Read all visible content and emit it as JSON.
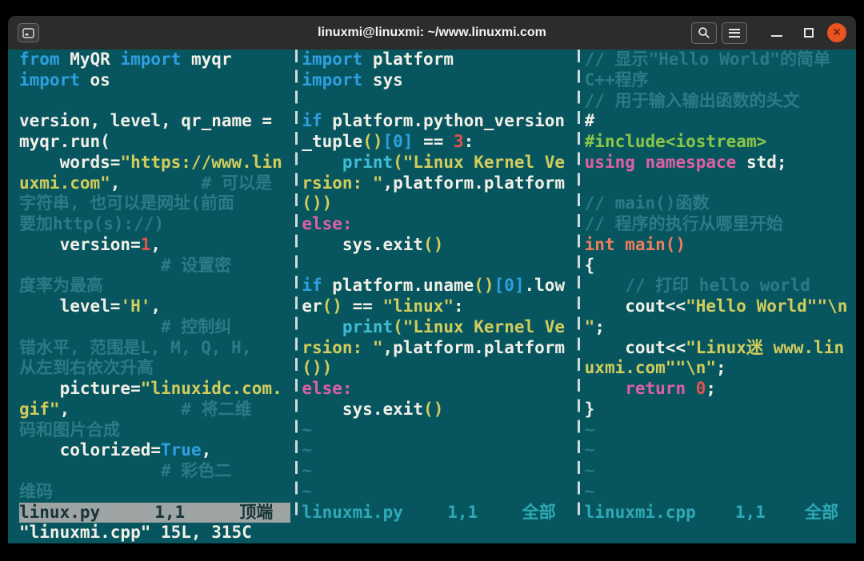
{
  "colors": {
    "bg": "#07565f",
    "fg": "#f2efe7",
    "kw": "#2f9fe0",
    "st": "#d2cc5c",
    "nm": "#e4524c",
    "fn": "#41bcd6",
    "mg": "#df5fa4",
    "gr": "#8bc546",
    "or": "#ef7e5e",
    "cm": "#2a7b85",
    "tl": "#2a7b85",
    "sfg": "#2fa9b6",
    "sabg": "#9ea4a3",
    "safg": "#17343a",
    "titlebg": "#2c2c2c",
    "titlefg": "#f3f3f3",
    "close": "#e95420",
    "btnborder": "#6e6e6e",
    "sep": "#cfdbdb"
  },
  "titlebar": {
    "title": "linuxmi@linuxmi: ~/www.linuxmi.com",
    "close_glyph": "✕"
  },
  "cmdline": "\"linuxmi.cpp\" 15L, 315C",
  "panes": [
    {
      "status": {
        "name": "linux.py",
        "ruler": "1,1",
        "pos": "顶端"
      },
      "lines": [
        [
          {
            "t": "from",
            "c": "kw"
          },
          {
            "t": " MyQR ",
            "c": "tx"
          },
          {
            "t": "import",
            "c": "kw"
          },
          {
            "t": " myqr",
            "c": "tx"
          }
        ],
        [
          {
            "t": "import",
            "c": "kw"
          },
          {
            "t": " os",
            "c": "tx"
          }
        ],
        [],
        [
          {
            "t": "version, level, qr_name =",
            "c": "tx"
          }
        ],
        [
          {
            "t": "myqr.run(",
            "c": "tx"
          }
        ],
        [
          {
            "t": "    words=",
            "c": "tx"
          },
          {
            "t": "\"https://www.lin",
            "c": "st"
          }
        ],
        [
          {
            "t": "uxmi.com\"",
            "c": "st"
          },
          {
            "t": ",        ",
            "c": "tx"
          },
          {
            "t": "# 可以是",
            "c": "cm"
          }
        ],
        [
          {
            "t": "字符串, 也可以是网址(前面",
            "c": "cm"
          }
        ],
        [
          {
            "t": "要加http(s)://)",
            "c": "cm"
          }
        ],
        [
          {
            "t": "    version=",
            "c": "tx"
          },
          {
            "t": "1",
            "c": "nm"
          },
          {
            "t": ",",
            "c": "tx"
          }
        ],
        [
          {
            "t": "              ",
            "c": "tx"
          },
          {
            "t": "# 设置密",
            "c": "cm"
          }
        ],
        [
          {
            "t": "度率为最高",
            "c": "cm"
          }
        ],
        [
          {
            "t": "    level=",
            "c": "tx"
          },
          {
            "t": "'H'",
            "c": "st"
          },
          {
            "t": ",",
            "c": "tx"
          }
        ],
        [
          {
            "t": "              ",
            "c": "tx"
          },
          {
            "t": "# 控制纠",
            "c": "cm"
          }
        ],
        [
          {
            "t": "错水平, 范围是L, M, Q, H,",
            "c": "cm"
          }
        ],
        [
          {
            "t": "从左到右依次升高",
            "c": "cm"
          }
        ],
        [
          {
            "t": "    picture=",
            "c": "tx"
          },
          {
            "t": "\"linuxidc.com.",
            "c": "st"
          }
        ],
        [
          {
            "t": "gif\"",
            "c": "st"
          },
          {
            "t": ",           ",
            "c": "tx"
          },
          {
            "t": "# 将二维",
            "c": "cm"
          }
        ],
        [
          {
            "t": "码和图片合成",
            "c": "cm"
          }
        ],
        [
          {
            "t": "    colorized=",
            "c": "tx"
          },
          {
            "t": "True",
            "c": "kw"
          },
          {
            "t": ",",
            "c": "tx"
          }
        ],
        [
          {
            "t": "              ",
            "c": "tx"
          },
          {
            "t": "# 彩色二",
            "c": "cm"
          }
        ],
        [
          {
            "t": "维码",
            "c": "cm"
          }
        ]
      ]
    },
    {
      "status": {
        "name": "linuxmi.py",
        "ruler": "1,1",
        "pos": "全部"
      },
      "lines": [
        [
          {
            "t": "import",
            "c": "kw"
          },
          {
            "t": " platform",
            "c": "tx"
          }
        ],
        [
          {
            "t": "import",
            "c": "kw"
          },
          {
            "t": " sys",
            "c": "tx"
          }
        ],
        [],
        [
          {
            "t": "if",
            "c": "kw"
          },
          {
            "t": " platform.python_version",
            "c": "tx"
          }
        ],
        [
          {
            "t": "_tuple",
            "c": "tx"
          },
          {
            "t": "()",
            "c": "st"
          },
          {
            "t": "[0]",
            "c": "kw"
          },
          {
            "t": " == ",
            "c": "tx"
          },
          {
            "t": "3",
            "c": "nm"
          },
          {
            "t": ":",
            "c": "tx"
          }
        ],
        [
          {
            "t": "    ",
            "c": "tx"
          },
          {
            "t": "print",
            "c": "fn"
          },
          {
            "t": "(\"Linux Kernel Ve",
            "c": "st"
          }
        ],
        [
          {
            "t": "rsion: \"",
            "c": "st"
          },
          {
            "t": ",platform.platform",
            "c": "tx"
          }
        ],
        [
          {
            "t": "())",
            "c": "st"
          }
        ],
        [
          {
            "t": "else:",
            "c": "mg"
          }
        ],
        [
          {
            "t": "    sys.exit",
            "c": "tx"
          },
          {
            "t": "()",
            "c": "st"
          }
        ],
        [],
        [
          {
            "t": "if",
            "c": "kw"
          },
          {
            "t": " platform.uname",
            "c": "tx"
          },
          {
            "t": "()",
            "c": "st"
          },
          {
            "t": "[0]",
            "c": "kw"
          },
          {
            "t": ".low",
            "c": "tx"
          }
        ],
        [
          {
            "t": "er",
            "c": "tx"
          },
          {
            "t": "()",
            "c": "st"
          },
          {
            "t": " == ",
            "c": "tx"
          },
          {
            "t": "\"linux\"",
            "c": "st"
          },
          {
            "t": ":",
            "c": "tx"
          }
        ],
        [
          {
            "t": "    ",
            "c": "tx"
          },
          {
            "t": "print",
            "c": "fn"
          },
          {
            "t": "(\"Linux Kernel Ve",
            "c": "st"
          }
        ],
        [
          {
            "t": "rsion: \"",
            "c": "st"
          },
          {
            "t": ",platform.platform",
            "c": "tx"
          }
        ],
        [
          {
            "t": "())",
            "c": "st"
          }
        ],
        [
          {
            "t": "else:",
            "c": "mg"
          }
        ],
        [
          {
            "t": "    sys.exit",
            "c": "tx"
          },
          {
            "t": "()",
            "c": "st"
          }
        ],
        [
          {
            "t": "~",
            "c": "tl"
          }
        ],
        [
          {
            "t": "~",
            "c": "tl"
          }
        ],
        [
          {
            "t": "~",
            "c": "tl"
          }
        ],
        [
          {
            "t": "~",
            "c": "tl"
          }
        ]
      ]
    },
    {
      "status": {
        "name": "linuxmi.cpp",
        "ruler": "1,1",
        "pos": "全部"
      },
      "lines": [
        [
          {
            "t": "// 显示\"Hello World\"的简单",
            "c": "cm"
          }
        ],
        [
          {
            "t": "C++程序",
            "c": "cm"
          }
        ],
        [
          {
            "t": "// 用于输入输出函数的头文",
            "c": "cm"
          }
        ],
        [
          {
            "t": "#",
            "c": "tx"
          }
        ],
        [
          {
            "t": "#include<iostream>",
            "c": "gr"
          }
        ],
        [
          {
            "t": "using namespace",
            "c": "mg"
          },
          {
            "t": " std;",
            "c": "tx"
          }
        ],
        [],
        [
          {
            "t": "// main()函数",
            "c": "cm"
          }
        ],
        [
          {
            "t": "// 程序的执行从哪里开始",
            "c": "cm"
          }
        ],
        [
          {
            "t": "int main()",
            "c": "or"
          }
        ],
        [
          {
            "t": "{",
            "c": "tx"
          }
        ],
        [
          {
            "t": "    ",
            "c": "tx"
          },
          {
            "t": "// 打印 hello world",
            "c": "cm"
          }
        ],
        [
          {
            "t": "    cout<<",
            "c": "tx"
          },
          {
            "t": "\"Hello World\"\"\\n",
            "c": "st"
          }
        ],
        [
          {
            "t": "\"",
            "c": "st"
          },
          {
            "t": ";",
            "c": "tx"
          }
        ],
        [
          {
            "t": "    cout<<",
            "c": "tx"
          },
          {
            "t": "\"Linux迷 www.lin",
            "c": "st"
          }
        ],
        [
          {
            "t": "uxmi.com\"\"\\n\"",
            "c": "st"
          },
          {
            "t": ";",
            "c": "tx"
          }
        ],
        [
          {
            "t": "    ",
            "c": "tx"
          },
          {
            "t": "return",
            "c": "mg"
          },
          {
            "t": " ",
            "c": "tx"
          },
          {
            "t": "0",
            "c": "nm"
          },
          {
            "t": ";",
            "c": "tx"
          }
        ],
        [
          {
            "t": "}",
            "c": "tx"
          }
        ],
        [
          {
            "t": "~",
            "c": "tl"
          }
        ],
        [
          {
            "t": "~",
            "c": "tl"
          }
        ],
        [
          {
            "t": "~",
            "c": "tl"
          }
        ],
        [
          {
            "t": "~",
            "c": "tl"
          }
        ]
      ]
    }
  ]
}
